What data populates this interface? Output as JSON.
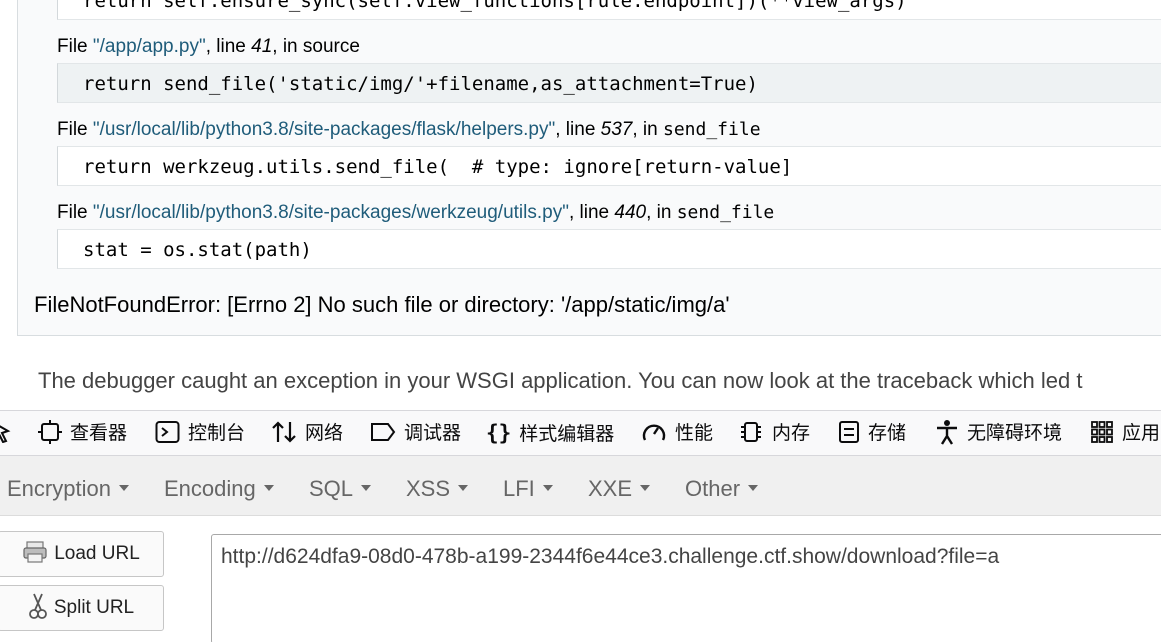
{
  "traceback": {
    "top_code": "return self.ensure_sync(self.view_functions[rule.endpoint])(**view_args)",
    "frames": [
      {
        "file_prefix": "File ",
        "path": "\"/app/app.py\"",
        "line_label": ", line ",
        "lineno": "41",
        "in_label": ", in ",
        "function": "source",
        "code": "return send_file('static/img/'+filename,as_attachment=True)"
      },
      {
        "file_prefix": "File ",
        "path": "\"/usr/local/lib/python3.8/site-packages/flask/helpers.py\"",
        "line_label": ", line ",
        "lineno": "537",
        "in_label": ", in ",
        "function": "send_file",
        "code": "return werkzeug.utils.send_file(  # type: ignore[return-value]"
      },
      {
        "file_prefix": "File ",
        "path": "\"/usr/local/lib/python3.8/site-packages/werkzeug/utils.py\"",
        "line_label": ", line ",
        "lineno": "440",
        "in_label": ", in ",
        "function": "send_file",
        "code": "stat = os.stat(path)"
      }
    ],
    "exception": "FileNotFoundError: [Errno 2] No such file or directory: '/app/static/img/a'"
  },
  "explanation": "The debugger caught an exception in your WSGI application. You can now look at the traceback which led t",
  "devtools": {
    "tabs": [
      {
        "label": "查看器",
        "icon": "inspector-icon"
      },
      {
        "label": "控制台",
        "icon": "console-icon"
      },
      {
        "label": "网络",
        "icon": "network-icon"
      },
      {
        "label": "调试器",
        "icon": "debugger-icon"
      },
      {
        "label": "样式编辑器",
        "icon": "style-editor-icon"
      },
      {
        "label": "性能",
        "icon": "performance-icon"
      },
      {
        "label": "内存",
        "icon": "memory-icon"
      },
      {
        "label": "存储",
        "icon": "storage-icon"
      },
      {
        "label": "无障碍环境",
        "icon": "accessibility-icon"
      },
      {
        "label": "应用",
        "icon": "application-icon"
      }
    ]
  },
  "hackbar": {
    "menu": [
      "Encryption",
      "Encoding",
      "SQL",
      "XSS",
      "LFI",
      "XXE",
      "Other"
    ],
    "load_url": "Load URL",
    "split_url": "Split URL",
    "url": "http://d624dfa9-08d0-478b-a199-2344f6e44ce3.challenge.ctf.show/download?file=a"
  }
}
